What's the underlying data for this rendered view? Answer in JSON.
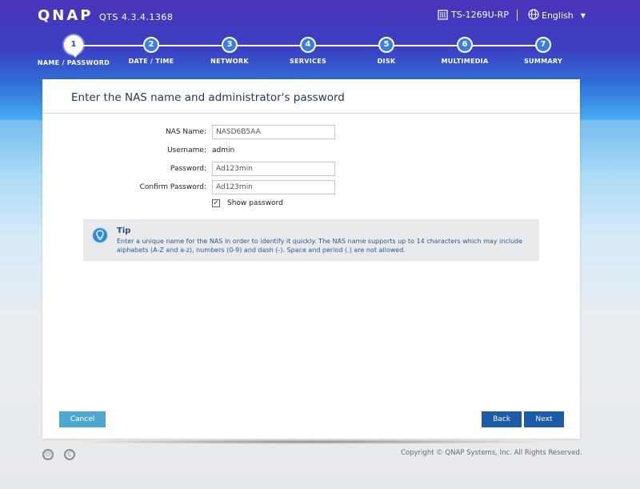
{
  "header": {
    "logo": "QNAP",
    "version": "QTS 4.3.4.1368",
    "model": "TS-1269U-RP",
    "language": "English"
  },
  "steps": [
    {
      "number": "1",
      "label": "NAME / PASSWORD",
      "active": true
    },
    {
      "number": "2",
      "label": "DATE / TIME"
    },
    {
      "number": "3",
      "label": "NETWORK"
    },
    {
      "number": "4",
      "label": "SERVICES"
    },
    {
      "number": "5",
      "label": "DISK"
    },
    {
      "number": "6",
      "label": "MULTIMEDIA"
    },
    {
      "number": "7",
      "label": "SUMMARY"
    }
  ],
  "panel": {
    "title": "Enter the NAS name and administrator's password",
    "nas_name_label": "NAS Name:",
    "nas_name_value": "NASD6B5AA",
    "username_label": "Username:",
    "username_value": "admin",
    "password_label": "Password:",
    "password_value": "Ad123min",
    "confirm_label": "Confirm Password:",
    "confirm_value": "Ad123min",
    "show_password_label": "Show password",
    "show_password_checked": true
  },
  "tip": {
    "title": "Tip",
    "text": "Enter a unique name for the NAS in order to identify it quickly. The NAS name supports up to 14 characters which may include alphabets (A-Z and a-z), numbers (0-9) and dash (-). Space and period (.) are not allowed."
  },
  "buttons": {
    "cancel": "Cancel",
    "back": "Back",
    "next": "Next"
  },
  "footer": {
    "copyright": "Copyright © QNAP Systems, Inc. All Rights Reserved."
  },
  "colors": {
    "accent": "#1b5ba8",
    "cancel": "#4ea7d0",
    "tip_text": "#2a5b8e"
  }
}
